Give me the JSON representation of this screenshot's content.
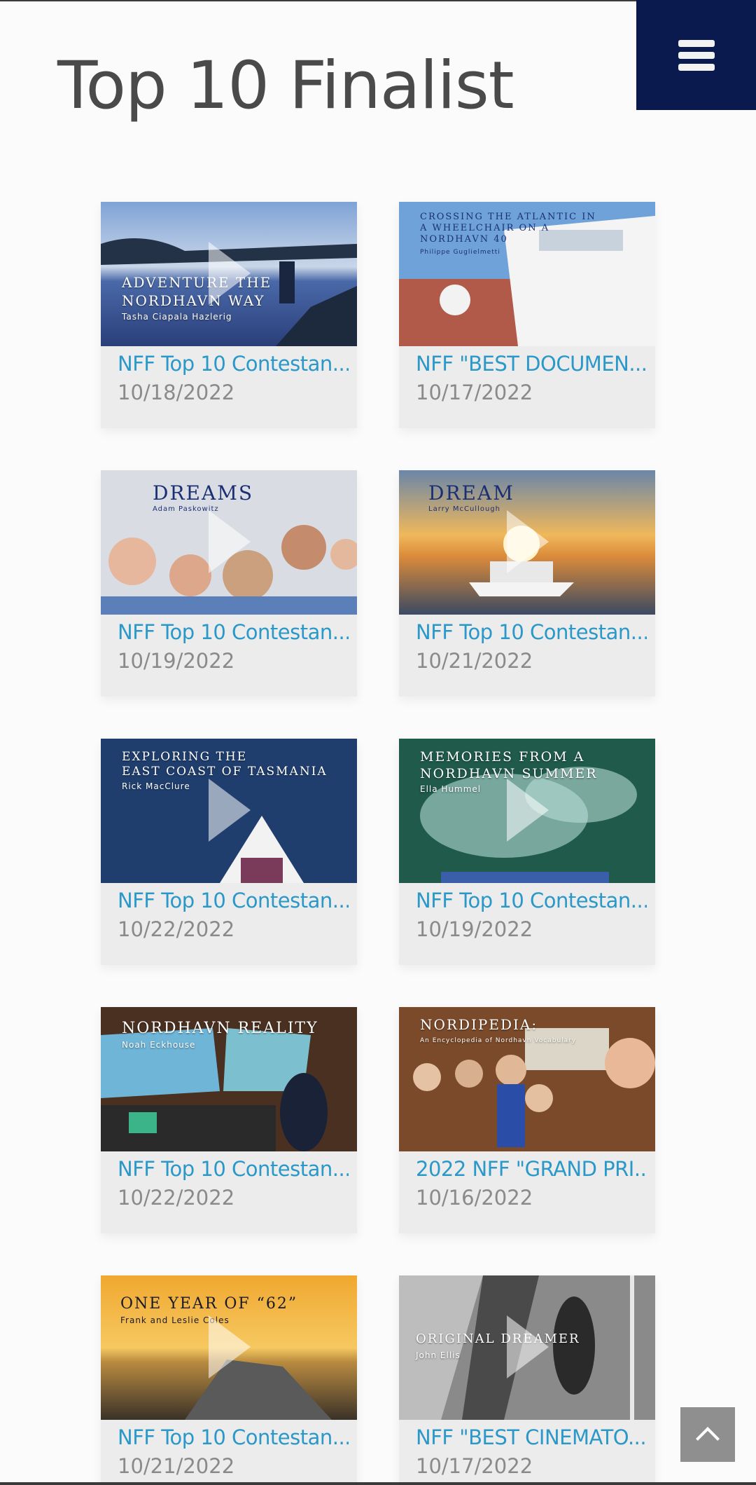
{
  "page": {
    "title": "Top 10 Finalist"
  },
  "menu": {
    "icon": "hamburger-icon"
  },
  "scroll_top": {
    "icon": "chevron-up-icon"
  },
  "colors": {
    "menu_bg": "#0b1a4e",
    "link": "#2a98c8",
    "date": "#8a8a8a"
  },
  "cards": [
    {
      "title": "NFF Top 10 Contestan...",
      "date": "10/18/2022",
      "thumb_title": "Adventure the\nNordhavn Way",
      "thumb_sub": "Tasha Ciapala Hazlerig"
    },
    {
      "title": "NFF \"BEST DOCUMEN...",
      "date": "10/17/2022",
      "thumb_title": "Crossing the Atlantic in\na wheelchair on a\nNordhavn 40",
      "thumb_sub": "Philippe Guglielmetti"
    },
    {
      "title": "NFF Top 10 Contestan...",
      "date": "10/19/2022",
      "thumb_title": "Dreams",
      "thumb_sub": "Adam Paskowitz"
    },
    {
      "title": "NFF Top 10 Contestan...",
      "date": "10/21/2022",
      "thumb_title": "Dream",
      "thumb_sub": "Larry McCullough"
    },
    {
      "title": "NFF Top 10 Contestan...",
      "date": "10/22/2022",
      "thumb_title": "Exploring the\nEast Coast of Tasmania",
      "thumb_sub": "Rick MacClure"
    },
    {
      "title": "NFF Top 10 Contestan...",
      "date": "10/19/2022",
      "thumb_title": "Memories from a\nNordhavn Summer",
      "thumb_sub": "Ella Hummel"
    },
    {
      "title": "NFF Top 10 Contestan...",
      "date": "10/22/2022",
      "thumb_title": "Nordhavn Reality",
      "thumb_sub": "Noah Eckhouse"
    },
    {
      "title": "2022 NFF \"GRAND PRI...",
      "date": "10/16/2022",
      "thumb_title": "Nordipedia:",
      "thumb_sub": "An Encyclopedia of Nordhavn Vocabulary"
    },
    {
      "title": "NFF Top 10 Contestan...",
      "date": "10/21/2022",
      "thumb_title": "One Year of “62”",
      "thumb_sub": "Frank and Leslie Coles"
    },
    {
      "title": "NFF \"BEST CINEMATO...",
      "date": "10/17/2022",
      "thumb_title": "Original Dreamer",
      "thumb_sub": "John Ellis"
    }
  ]
}
